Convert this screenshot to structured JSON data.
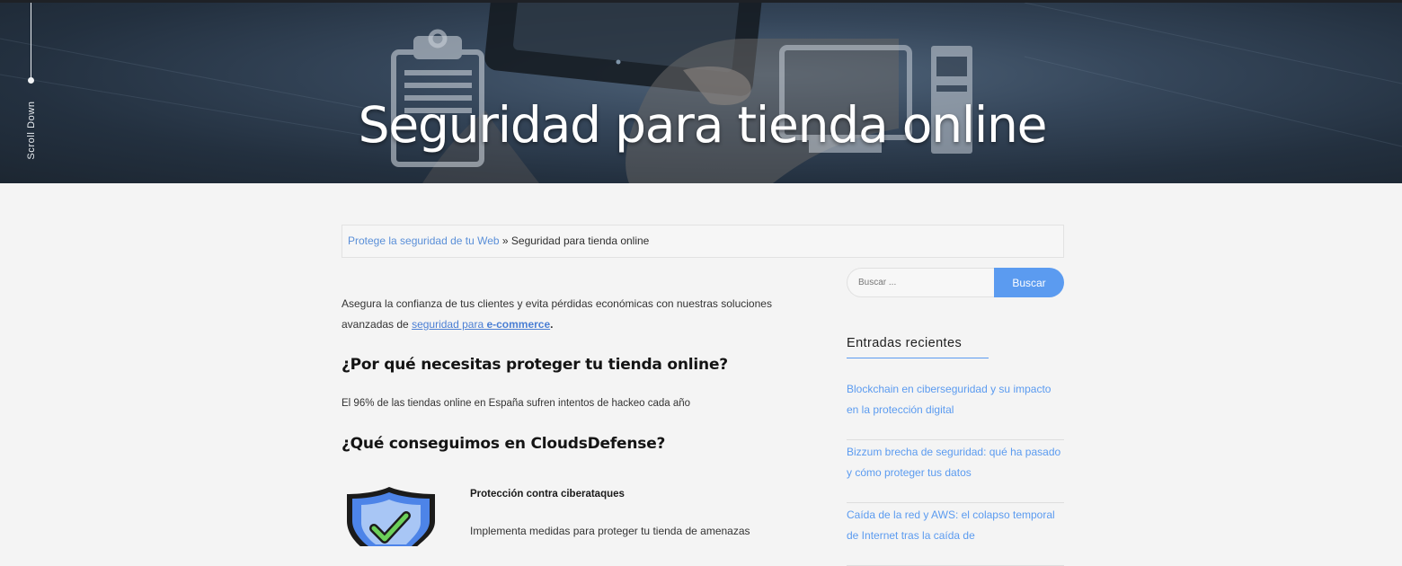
{
  "hero": {
    "scroll_label": "Scroll Down",
    "title": "Seguridad para tienda online"
  },
  "breadcrumb": {
    "link": "Protege la seguridad de tu Web",
    "separator": " » ",
    "current": "Seguridad para tienda online"
  },
  "content": {
    "intro_text": "Asegura la confianza de tus clientes y evita pérdidas económicas con nuestras soluciones avanzadas de ",
    "intro_link_plain": "seguridad para ",
    "intro_link_bold": "e-commerce",
    "intro_end": ".",
    "heading_1": "¿Por qué necesitas proteger tu tienda online?",
    "stat_text": "El 96% de las tiendas online en España sufren intentos de hackeo cada año",
    "heading_2": "¿Qué conseguimos en CloudsDefense?",
    "feature_title": "Protección contra ciberataques",
    "feature_desc": "Implementa medidas para proteger tu tienda de amenazas"
  },
  "sidebar": {
    "search_placeholder": "Buscar ...",
    "search_button": "Buscar",
    "recent_title": "Entradas recientes",
    "recent_posts": [
      "Blockchain en ciberseguridad y su impacto en la protección digital",
      "Bizzum brecha de seguridad: qué ha pasado y cómo proteger tus datos",
      "Caída de la red y AWS: el colapso temporal de Internet tras la caída de"
    ]
  },
  "colors": {
    "accent": "#5b9bf0",
    "link": "#4b7fd4",
    "hero_dark": "#1c2631",
    "page_bg": "#f4f4f4"
  }
}
